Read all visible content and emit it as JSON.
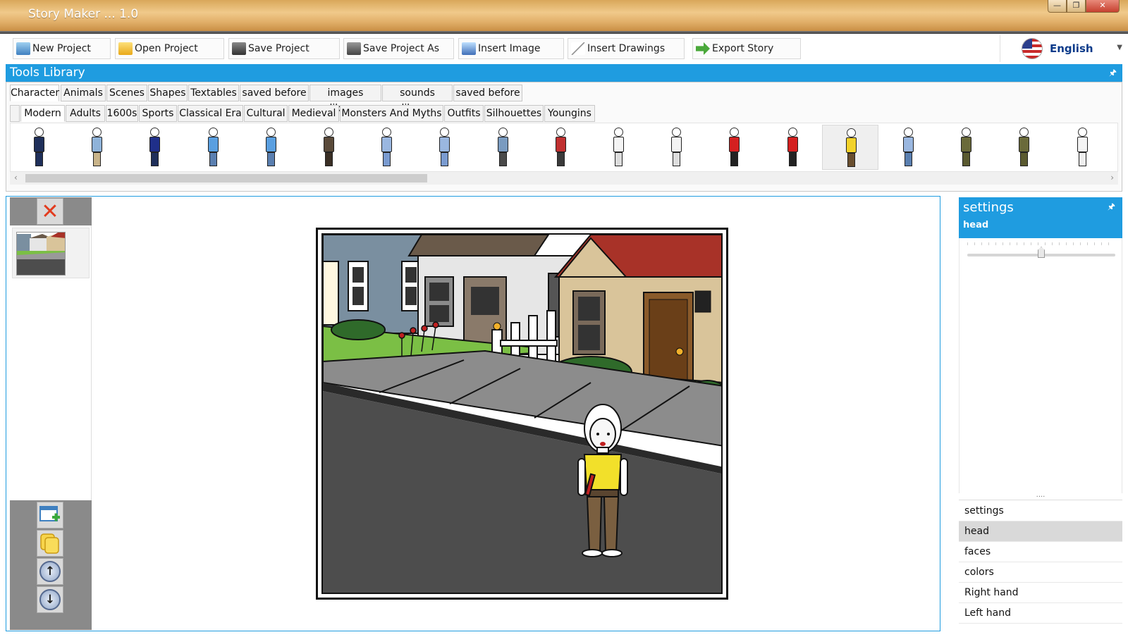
{
  "window": {
    "title": "Story Maker ... 1.0",
    "minimize": "—",
    "maximize": "❐",
    "close": "✕"
  },
  "toolbar": {
    "buttons": [
      {
        "label": "New Project",
        "icon": "new-project-icon",
        "color": "#4a90c8"
      },
      {
        "label": "Open Project",
        "icon": "open-folder-icon",
        "color": "#f2c23a"
      },
      {
        "label": "Save Project",
        "icon": "save-disk-icon",
        "color": "#555555"
      },
      {
        "label": "Save Project As",
        "icon": "save-as-icon",
        "color": "#666666"
      },
      {
        "label": "Insert Image",
        "icon": "insert-image-icon",
        "color": "#3f6fb8"
      },
      {
        "label": "Insert Drawings",
        "icon": "pencil-icon",
        "color": "#999999"
      },
      {
        "label": "Export Story",
        "icon": "export-arrow-icon",
        "color": "#4aa83a"
      }
    ],
    "language": "English"
  },
  "tools": {
    "title": "Tools Library",
    "pin": "🖈",
    "tabs": [
      "Character",
      "Animals",
      "Scenes",
      "Shapes",
      "Textables",
      "saved before",
      "images library",
      "sounds library",
      "saved before"
    ],
    "subtabs": [
      "Modern",
      "Adults",
      "1600s",
      "Sports",
      "Classical Era",
      "Cultural",
      "Medieval",
      "Monsters And Myths",
      "Outfits",
      "Silhouettes",
      "Youngins"
    ],
    "characters": [
      {
        "body": "#1f2f5a",
        "legs": "#1f2f5a"
      },
      {
        "body": "#8fb3d9",
        "legs": "#c9b48a"
      },
      {
        "body": "#1f2f8a",
        "legs": "#1f2f5a"
      },
      {
        "body": "#5a9fe0",
        "legs": "#5a7fb0"
      },
      {
        "body": "#5a9fe0",
        "legs": "#5a7fb0"
      },
      {
        "body": "#5a4a3a",
        "legs": "#3a2f25"
      },
      {
        "body": "#9ab7e0",
        "legs": "#7a9bd0"
      },
      {
        "body": "#9ab7e0",
        "legs": "#7a9bd0"
      },
      {
        "body": "#7a9bc0",
        "legs": "#4a4a4a"
      },
      {
        "body": "#c03030",
        "legs": "#3a3a3a"
      },
      {
        "body": "#f4f4f4",
        "legs": "#dddddd"
      },
      {
        "body": "#f4f4f4",
        "legs": "#dddddd"
      },
      {
        "body": "#d42020",
        "legs": "#222222"
      },
      {
        "body": "#d42020",
        "legs": "#222222"
      },
      {
        "body": "#f2d22a",
        "legs": "#6a4f2f"
      },
      {
        "body": "#9ab7e0",
        "legs": "#5a7fb0"
      },
      {
        "body": "#6a6a3a",
        "legs": "#5a5a30"
      },
      {
        "body": "#6a6a3a",
        "legs": "#5a5a30"
      },
      {
        "body": "#f4f4f4",
        "legs": "#eeeeee"
      }
    ],
    "selected_character": 14
  },
  "scenes": {
    "thumbnail_count": 1
  },
  "settings": {
    "title": "settings",
    "subtitle": "head",
    "slider_value": 0.5,
    "items": [
      "settings",
      "head",
      "faces",
      "colors",
      "Right hand",
      "Left hand"
    ],
    "active_item": "head"
  },
  "colors": {
    "accent": "#1f9ce0",
    "sky": "#ffffff",
    "road": "#4d4d4d",
    "sidewalk": "#8c8c8c",
    "grass": "#7bbf45"
  }
}
